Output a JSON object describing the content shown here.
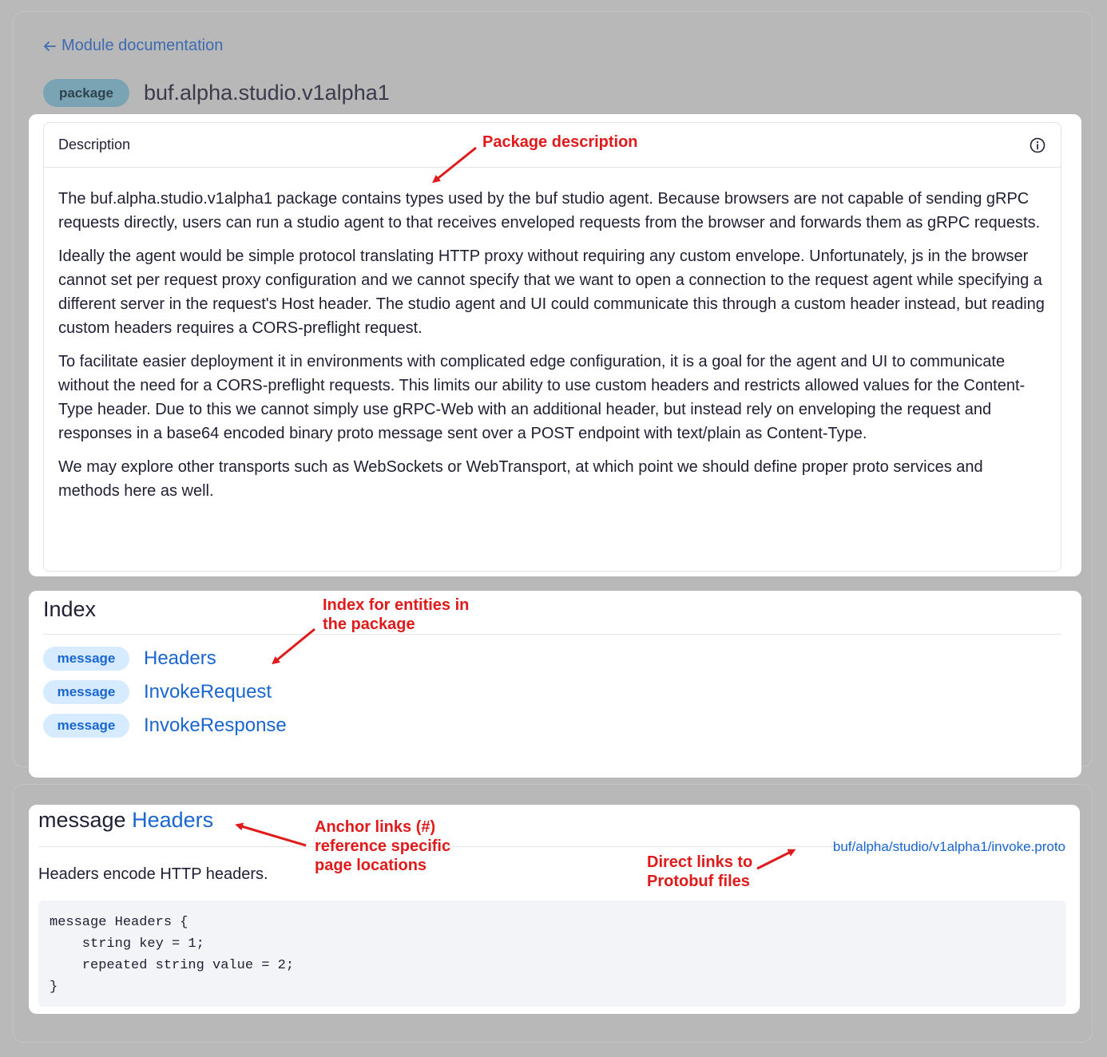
{
  "nav": {
    "back_label": "Module documentation"
  },
  "package": {
    "badge": "package",
    "name": "buf.alpha.studio.v1alpha1"
  },
  "description": {
    "header": "Description",
    "paragraphs": [
      "The buf.alpha.studio.v1alpha1 package contains types used by the buf studio agent. Because browsers are not capable of sending gRPC requests directly, users can run a studio agent to that receives enveloped requests from the browser and forwards them as gRPC requests.",
      "Ideally the agent would be simple protocol translating HTTP proxy without requiring any custom envelope. Unfortunately, js in the browser cannot set per request proxy configuration and we cannot specify that we want to open a connection to the request agent while specifying a different server in the request's Host header. The studio agent and UI could communicate this through a custom header instead, but reading custom headers requires a CORS-preflight request.",
      "To facilitate easier deployment it in environments with complicated edge configuration, it is a goal for the agent and UI to communicate without the need for a CORS-preflight requests. This limits our ability to use custom headers and restricts allowed values for the Content-Type header. Due to this we cannot simply use gRPC-Web with an additional header, but instead rely on enveloping the request and responses in a base64 encoded binary proto message sent over a POST endpoint with text/plain as Content-Type.",
      "We may explore other transports such as WebSockets or WebTransport, at which point we should define proper proto services and methods here as well."
    ]
  },
  "index": {
    "title": "Index",
    "items": [
      {
        "badge": "message",
        "name": "Headers"
      },
      {
        "badge": "message",
        "name": "InvokeRequest"
      },
      {
        "badge": "message",
        "name": "InvokeResponse"
      }
    ]
  },
  "message_section": {
    "kind": "message",
    "name": "Headers",
    "file_link": "buf/alpha/studio/v1alpha1/invoke.proto",
    "description": "Headers encode HTTP headers.",
    "code": "message Headers {\n    string key = 1;\n    repeated string value = 2;\n}"
  },
  "annotations": {
    "package_description": "Package description",
    "index_line1": "Index for entities in",
    "index_line2": "the package",
    "anchor_line1": "Anchor links (#)",
    "anchor_line2": "reference specific",
    "anchor_line3": "page locations",
    "direct_line1": "Direct links to",
    "direct_line2": "Protobuf files"
  },
  "colors": {
    "annotation": "#e01a1a",
    "link": "#1a66d0",
    "badge_message_bg": "#d6ebff",
    "badge_package_bg": "#7aa4b4",
    "backdrop": "#b9b9b9"
  }
}
